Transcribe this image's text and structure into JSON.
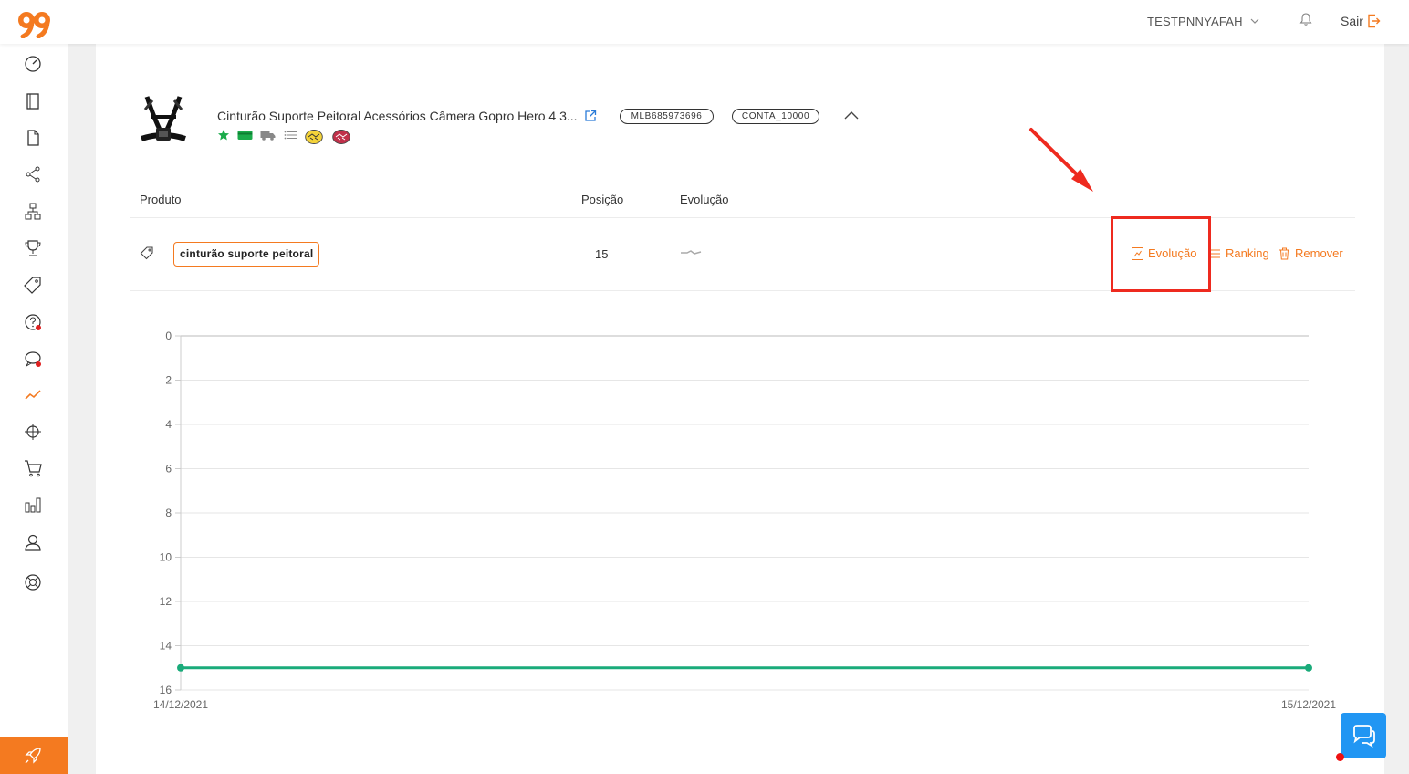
{
  "colors": {
    "accent": "#f47a20",
    "chart_line": "#1aab7a",
    "highlight": "#ee2a1f",
    "chat": "#2196f3",
    "link": "#2a7bd8"
  },
  "header": {
    "user_name": "TESTPNNYAFAH",
    "logout_label": "Sair"
  },
  "sidebar": {
    "items": [
      {
        "icon": "speedometer-icon"
      },
      {
        "icon": "notebook-icon"
      },
      {
        "icon": "document-icon"
      },
      {
        "icon": "share-icon"
      },
      {
        "icon": "sitemap-icon"
      },
      {
        "icon": "trophy-icon"
      },
      {
        "icon": "price-tag-icon"
      },
      {
        "icon": "question-icon",
        "dot": true
      },
      {
        "icon": "chat-bubble-icon",
        "dot": true
      },
      {
        "icon": "trend-line-icon",
        "active": true
      },
      {
        "icon": "crosshair-icon"
      },
      {
        "icon": "cart-icon"
      },
      {
        "icon": "bar-chart-icon"
      },
      {
        "icon": "user-icon"
      },
      {
        "icon": "lifebuoy-icon"
      }
    ],
    "footer_icon": "rocket-icon"
  },
  "product": {
    "title": "Cinturão Suporte Peitoral Acessórios Câmera Gopro Hero 4 3...",
    "mlb_id": "MLB685973696",
    "account": "CONTA_10000"
  },
  "table": {
    "headers": {
      "product": "Produto",
      "position": "Posição",
      "evolution": "Evolução"
    },
    "row": {
      "keyword": "cinturão suporte peitoral",
      "position": "15"
    },
    "actions": {
      "evolution": "Evolução",
      "ranking": "Ranking",
      "remove": "Remover"
    }
  },
  "chart_data": {
    "type": "line",
    "x": [
      "14/12/2021",
      "15/12/2021"
    ],
    "series": [
      {
        "values": [
          15,
          15
        ]
      }
    ],
    "y_ticks": [
      0,
      2,
      4,
      6,
      8,
      10,
      12,
      14,
      16
    ],
    "ylim": [
      0,
      16
    ],
    "y_inverted": true,
    "grid": true
  }
}
